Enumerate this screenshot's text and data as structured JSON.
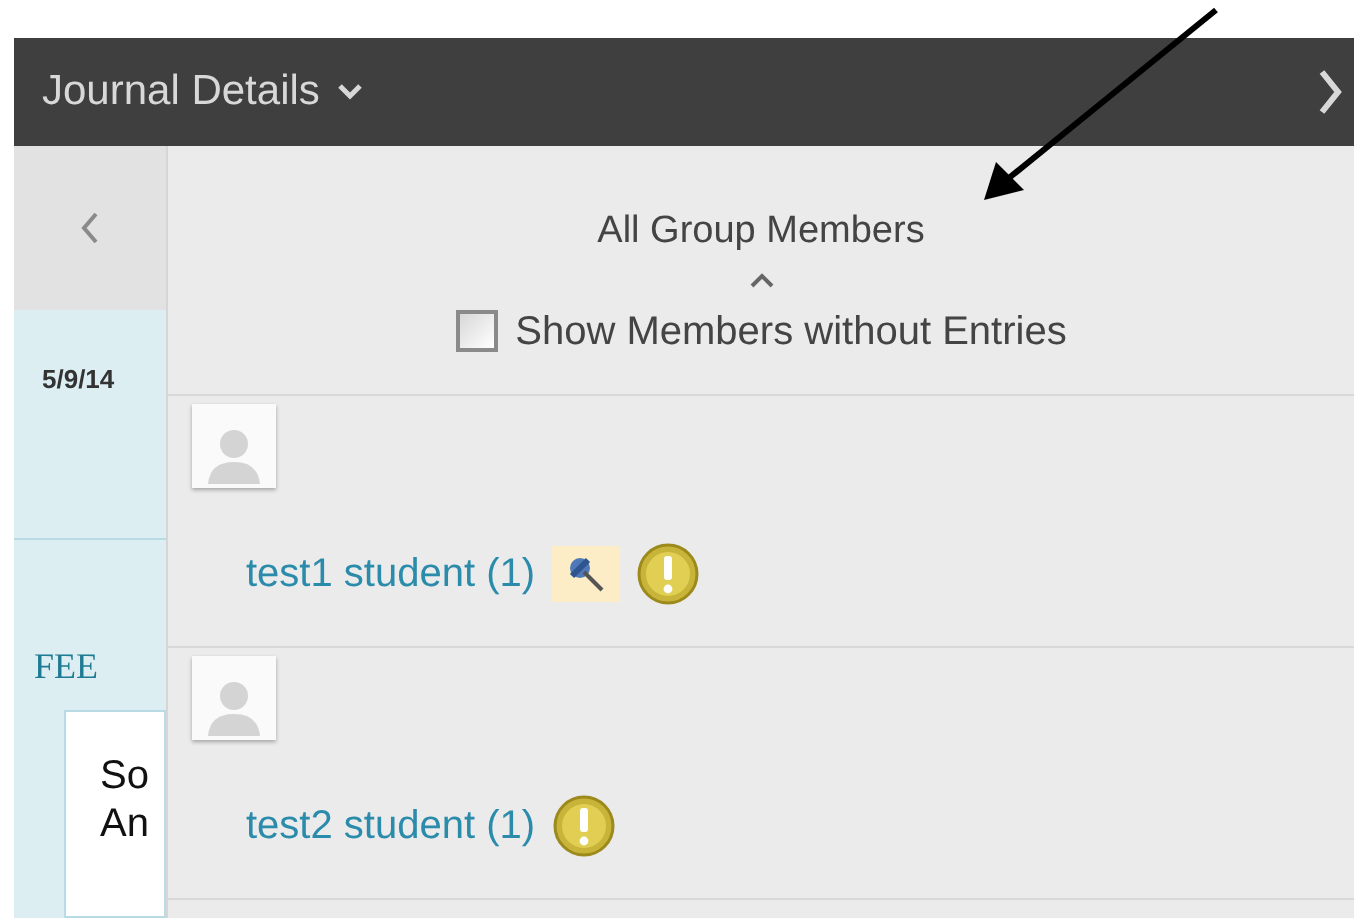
{
  "header": {
    "title": "Journal Details"
  },
  "side": {
    "date": "5/9/14",
    "heading": "FEE",
    "lines": [
      "So",
      "An"
    ]
  },
  "panel": {
    "title": "All Group Members",
    "checkbox": {
      "label": "Show Members without Entries",
      "checked": false
    },
    "members": [
      {
        "name": "test1 student (1)",
        "pinned": true
      },
      {
        "name": "test2 student (1)",
        "pinned": false
      }
    ]
  }
}
